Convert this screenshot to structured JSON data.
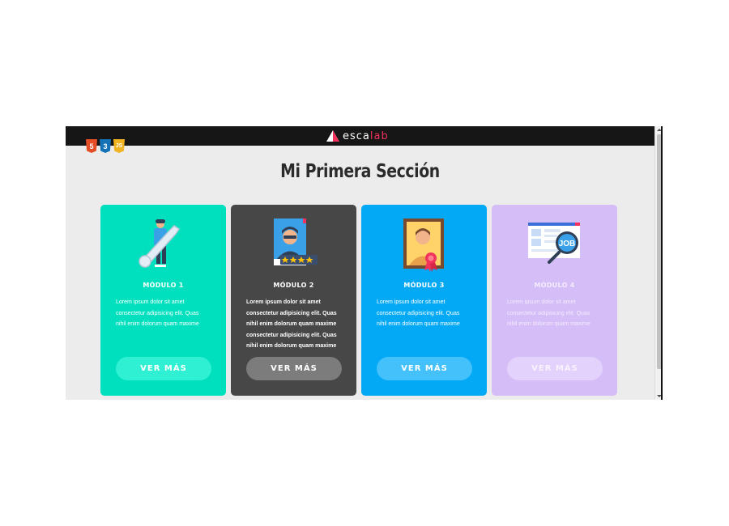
{
  "header": {
    "brand_prefix": "esca",
    "brand_suffix": "lab"
  },
  "tech_badges": [
    "5",
    "3",
    "JS"
  ],
  "section": {
    "title": "Mi Primera Sección"
  },
  "cards": [
    {
      "title": "MÓDULO 1",
      "lines": [
        "Lorem ipsum dolor sit amet",
        "consectetur adipisicing elit. Quas",
        "nihil enim dolorum quam maxime"
      ],
      "button": "VER MÁS",
      "color": "#00e0be"
    },
    {
      "title": "MÓDULO 2",
      "lines": [
        "Lorem ipsum dolor sit amet",
        "consectetur adipisicing elit. Quas",
        "nihil enim dolorum quam maxime",
        "consectetur adipisicing elit. Quas",
        "nihil enim dolorum quam maxime"
      ],
      "button": "VER MÁS",
      "color": "#474747"
    },
    {
      "title": "MÓDULO 3",
      "lines": [
        "Lorem ipsum dolor sit amet",
        "consectetur adipisicing elit. Quas",
        "nihil enim dolorum quam maxime"
      ],
      "button": "VER MÁS",
      "color": "#03a9f4"
    },
    {
      "title": "MÓDULO 4",
      "lines": [
        "Lorem ipsum dolor sit amet",
        "consectetur adipisicing elit. Quas",
        "nihil enim dolorum quam maxime"
      ],
      "button": "VER MÁS",
      "color": "#d5bdf7",
      "illustration_text": "JOB"
    }
  ],
  "colors": {
    "topbar": "#161616",
    "brand_accent": "#f0325c",
    "page_background": "#ececec"
  },
  "icons": [
    "escalab-logo-icon",
    "html5-icon",
    "css3-icon",
    "js-icon",
    "key-person-icon",
    "profile-rating-icon",
    "portrait-award-icon",
    "job-search-icon"
  ]
}
